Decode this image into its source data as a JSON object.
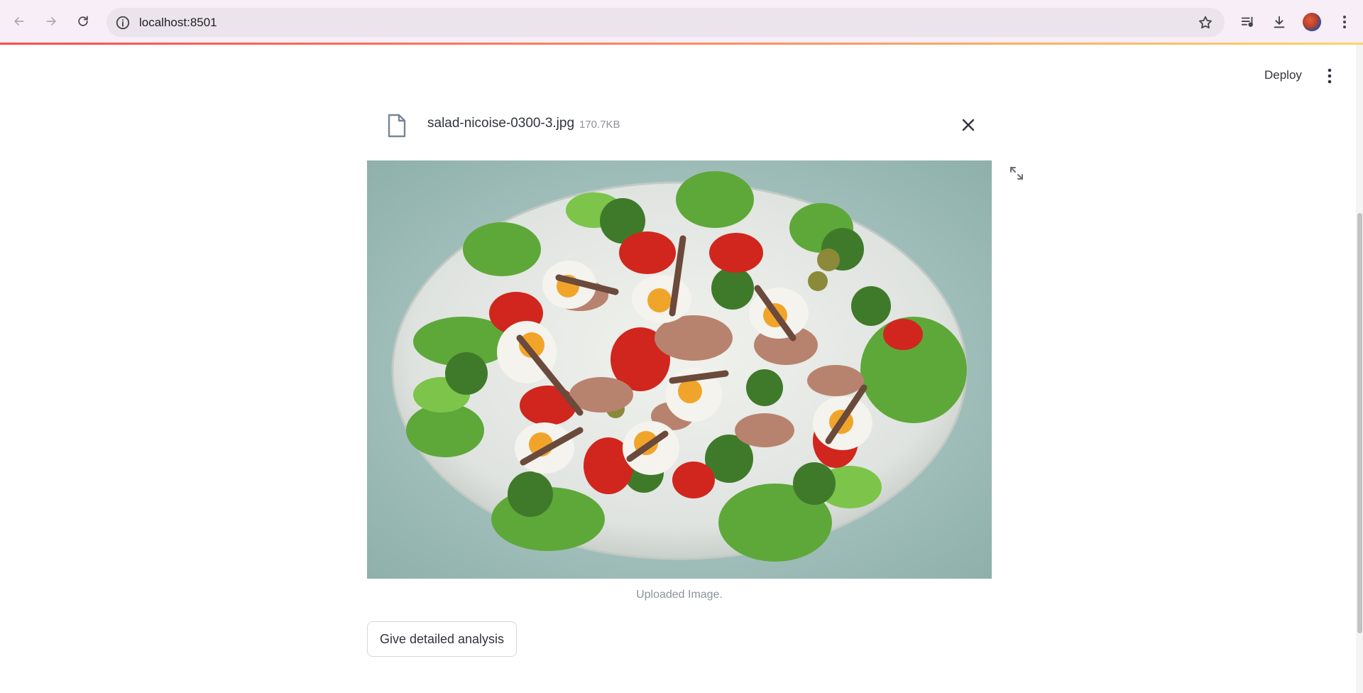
{
  "browser": {
    "url": "localhost:8501",
    "icons": [
      "back-arrow-icon",
      "forward-arrow-icon",
      "reload-icon",
      "site-info-icon",
      "bookmark-star-icon",
      "media-controls-icon",
      "download-icon",
      "profile-avatar",
      "browser-menu-icon"
    ]
  },
  "app": {
    "deploy_label": "Deploy",
    "uploader": {
      "file_name": "salad-nicoise-0300-3.jpg",
      "file_size": "170.7KB"
    },
    "image": {
      "caption": "Uploaded Image."
    },
    "analyze_button_label": "Give detailed analysis"
  },
  "colors": {
    "accent_gradient_start": "#ff4b4b",
    "accent_gradient_end": "#ffd36b",
    "text": "#31333f",
    "muted_text": "#8e929c"
  }
}
